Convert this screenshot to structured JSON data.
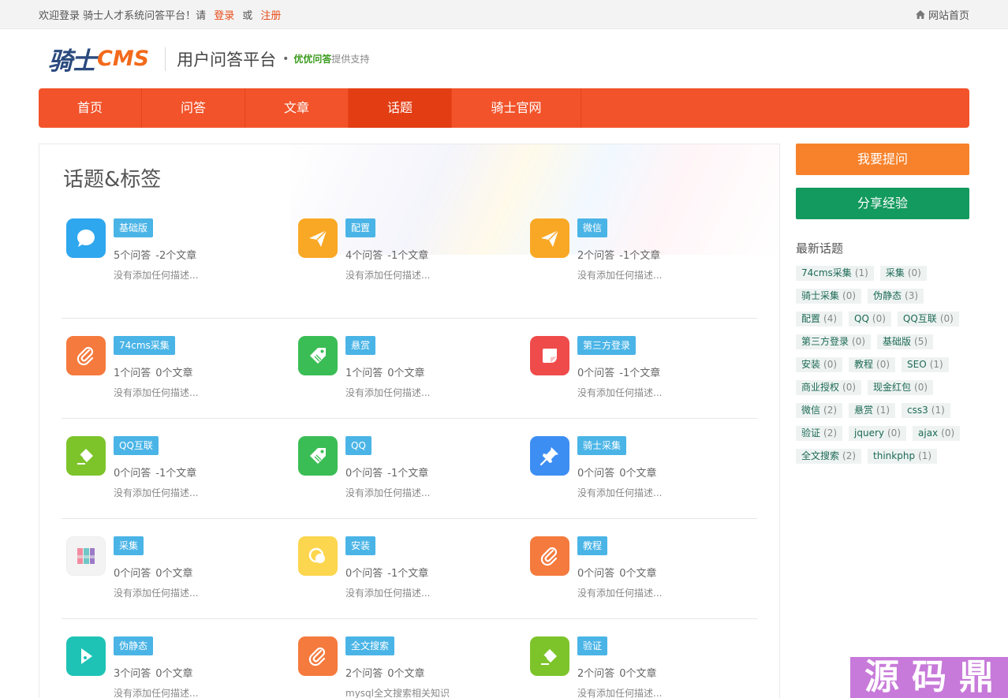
{
  "topbar": {
    "welcome": "欢迎登录 骑士人才系统问答平台！请",
    "login": "登录",
    "or": "或",
    "register": "注册",
    "home_link": "网站首页"
  },
  "header": {
    "logo_cn": "骑士",
    "logo_en": "CMS",
    "title": "用户问答平台",
    "dot": "•",
    "support_brand": "优优问答",
    "support_text": "提供支持"
  },
  "nav": {
    "items": [
      {
        "label": "首页"
      },
      {
        "label": "问答"
      },
      {
        "label": "文章"
      },
      {
        "label": "话题"
      },
      {
        "label": "骑士官网"
      }
    ],
    "active_index": 3
  },
  "main": {
    "title": "话题&标签",
    "topics": [
      {
        "tag": "基础版",
        "answers": "5个问答",
        "articles": "-2个文章",
        "desc": "没有添加任何描述...",
        "icon": "chat-bubble-icon",
        "color": "#2ea7ee"
      },
      {
        "tag": "配置",
        "answers": "4个问答",
        "articles": "-1个文章",
        "desc": "没有添加任何描述...",
        "icon": "paper-plane-icon",
        "color": "#f9a825"
      },
      {
        "tag": "微信",
        "answers": "2个问答",
        "articles": "-1个文章",
        "desc": "没有添加任何描述...",
        "icon": "paper-plane-icon",
        "color": "#f9a825"
      },
      {
        "tag": "74cms采集",
        "answers": "1个问答",
        "articles": "0个文章",
        "desc": "没有添加任何描述...",
        "icon": "paperclip-icon",
        "color": "#f57a3d"
      },
      {
        "tag": "悬赏",
        "answers": "1个问答",
        "articles": "0个文章",
        "desc": "没有添加任何描述...",
        "icon": "price-tag-icon",
        "color": "#3bbd55"
      },
      {
        "tag": "第三方登录",
        "answers": "0个问答",
        "articles": "-1个文章",
        "desc": "没有添加任何描述...",
        "icon": "note-icon",
        "color": "#ef4b4b"
      },
      {
        "tag": "QQ互联",
        "answers": "0个问答",
        "articles": "-1个文章",
        "desc": "没有添加任何描述...",
        "icon": "eraser-icon",
        "color": "#7dc42b"
      },
      {
        "tag": "QQ",
        "answers": "0个问答",
        "articles": "-1个文章",
        "desc": "没有添加任何描述...",
        "icon": "price-tag-icon",
        "color": "#3bbd55"
      },
      {
        "tag": "骑士采集",
        "answers": "0个问答",
        "articles": "0个文章",
        "desc": "没有添加任何描述...",
        "icon": "pushpin-icon",
        "color": "#3d8ef3"
      },
      {
        "tag": "采集",
        "answers": "0个问答",
        "articles": "0个文章",
        "desc": "没有添加任何描述...",
        "icon": "palette-grid-icon",
        "color": "#f3f3f3"
      },
      {
        "tag": "安装",
        "answers": "0个问答",
        "articles": "-1个文章",
        "desc": "没有添加任何描述...",
        "icon": "coins-icon",
        "color": "#fcd64e"
      },
      {
        "tag": "教程",
        "answers": "0个问答",
        "articles": "0个文章",
        "desc": "没有添加任何描述...",
        "icon": "paperclip-icon",
        "color": "#f57a3d"
      },
      {
        "tag": "伪静态",
        "answers": "3个问答",
        "articles": "0个文章",
        "desc": "没有添加任何描述...",
        "icon": "play-flag-icon",
        "color": "#1fc3b6"
      },
      {
        "tag": "全文搜索",
        "answers": "2个问答",
        "articles": "0个文章",
        "desc": "mysql全文搜索相关知识",
        "icon": "paperclip-icon",
        "color": "#f57a3d"
      },
      {
        "tag": "验证",
        "answers": "2个问答",
        "articles": "0个文章",
        "desc": "没有添加任何描述...",
        "icon": "eraser-icon",
        "color": "#7dc42b"
      }
    ]
  },
  "sidebar": {
    "ask_button": "我要提问",
    "share_button": "分享经验",
    "latest_title": "最新话题",
    "tags": [
      {
        "name": "74cms采集",
        "count": "(1)"
      },
      {
        "name": "采集",
        "count": "(0)"
      },
      {
        "name": "骑士采集",
        "count": "(0)"
      },
      {
        "name": "伪静态",
        "count": "(3)"
      },
      {
        "name": "配置",
        "count": "(4)"
      },
      {
        "name": "QQ",
        "count": "(0)"
      },
      {
        "name": "QQ互联",
        "count": "(0)"
      },
      {
        "name": "第三方登录",
        "count": "(0)"
      },
      {
        "name": "基础版",
        "count": "(5)"
      },
      {
        "name": "安装",
        "count": "(0)"
      },
      {
        "name": "教程",
        "count": "(0)"
      },
      {
        "name": "SEO",
        "count": "(1)"
      },
      {
        "name": "商业授权",
        "count": "(0)"
      },
      {
        "name": "现金红包",
        "count": "(0)"
      },
      {
        "name": "微信",
        "count": "(2)"
      },
      {
        "name": "悬赏",
        "count": "(1)"
      },
      {
        "name": "css3",
        "count": "(1)"
      },
      {
        "name": "验证",
        "count": "(2)"
      },
      {
        "name": "jquery",
        "count": "(0)"
      },
      {
        "name": "ajax",
        "count": "(0)"
      },
      {
        "name": "全文搜索",
        "count": "(2)"
      },
      {
        "name": "thinkphp",
        "count": "(1)"
      }
    ]
  },
  "watermark": {
    "chars": [
      "源",
      "码",
      "鼎"
    ]
  }
}
